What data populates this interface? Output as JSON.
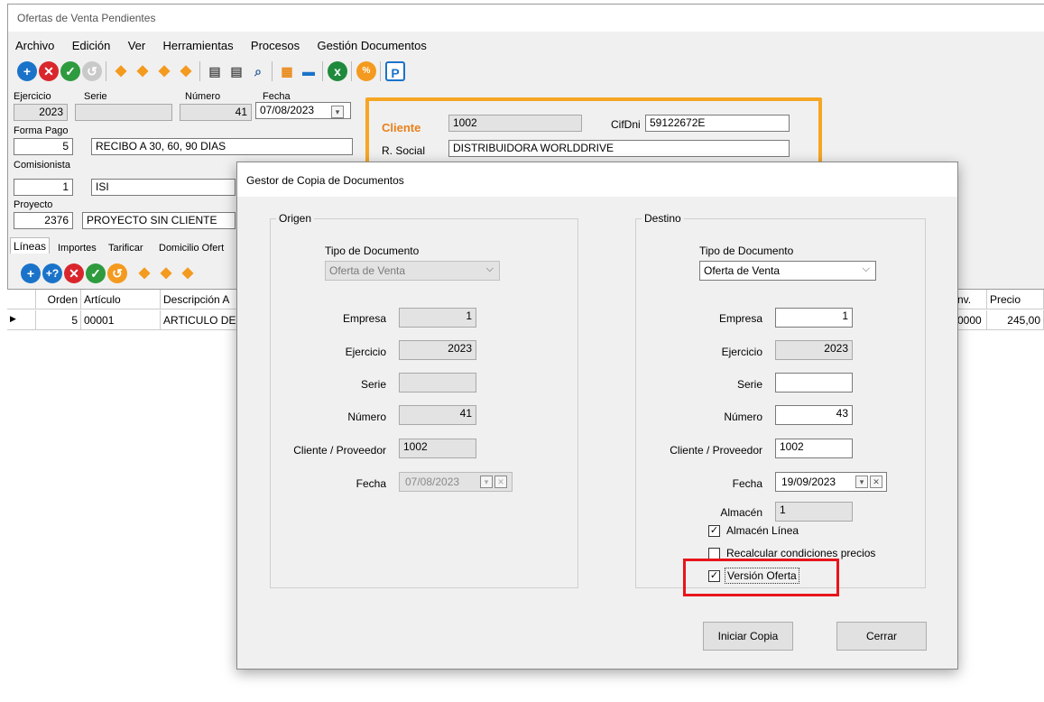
{
  "window": {
    "title": "Ofertas de Venta Pendientes"
  },
  "menu": [
    "Archivo",
    "Edición",
    "Ver",
    "Herramientas",
    "Procesos",
    "Gestión Documentos"
  ],
  "header": {
    "ejercicio_label": "Ejercicio",
    "ejercicio": "2023",
    "serie_label": "Serie",
    "serie": "",
    "numero_label": "Número",
    "numero": "41",
    "fecha_label": "Fecha",
    "fecha": "07/08/2023",
    "forma_pago_label": "Forma Pago",
    "forma_pago_code": "5",
    "forma_pago_desc": "RECIBO A 30, 60, 90 DIAS",
    "comisionista_label": "Comisionista",
    "comisionista_code": "1",
    "comisionista_desc": "ISI",
    "proyecto_label": "Proyecto",
    "proyecto_code": "2376",
    "proyecto_desc": "PROYECTO SIN CLIENTE"
  },
  "cliente": {
    "label": "Cliente",
    "code": "1002",
    "cifdni_label": "CifDni",
    "cifdni": "59122672E",
    "rsocial_label": "R. Social",
    "rsocial": "DISTRIBUIDORA  WORLDDRIVE"
  },
  "tabs": [
    "Líneas",
    "Importes",
    "Tarificar",
    "Domicilio Ofert"
  ],
  "grid": {
    "columns": [
      "Orden",
      "Artículo",
      "Descripción A",
      "nv.",
      "Precio"
    ],
    "row": {
      "orden": "5",
      "articulo": "00001",
      "descripcion": "ARTICULO DE",
      "conv": "0000",
      "precio": "245,00"
    }
  },
  "dialog": {
    "title": "Gestor de Copia de Documentos",
    "origen": {
      "group": "Origen",
      "tipo_label": "Tipo de Documento",
      "tipo": "Oferta de Venta",
      "empresa_label": "Empresa",
      "empresa": "1",
      "ejercicio_label": "Ejercicio",
      "ejercicio": "2023",
      "serie_label": "Serie",
      "serie": "",
      "numero_label": "Número",
      "numero": "41",
      "cliente_label": "Cliente / Proveedor",
      "cliente": "1002",
      "fecha_label": "Fecha",
      "fecha": "07/08/2023"
    },
    "destino": {
      "group": "Destino",
      "tipo_label": "Tipo de Documento",
      "tipo": "Oferta de Venta",
      "empresa_label": "Empresa",
      "empresa": "1",
      "ejercicio_label": "Ejercicio",
      "ejercicio": "2023",
      "serie_label": "Serie",
      "serie": "",
      "numero_label": "Número",
      "numero": "43",
      "cliente_label": "Cliente / Proveedor",
      "cliente": "1002",
      "fecha_label": "Fecha",
      "fecha": "19/09/2023",
      "almacen_label": "Almacén",
      "almacen": "1",
      "chk_almacen_linea": "Almacén Línea",
      "chk_recalcular": "Recalcular condiciones precios",
      "chk_version": "Versión Oferta"
    },
    "btn_iniciar": "Iniciar Copia",
    "btn_cerrar": "Cerrar"
  },
  "colors": {
    "highlight_red": "#e8141c",
    "client_border": "#f5a623",
    "client_label": "#e8801a"
  }
}
